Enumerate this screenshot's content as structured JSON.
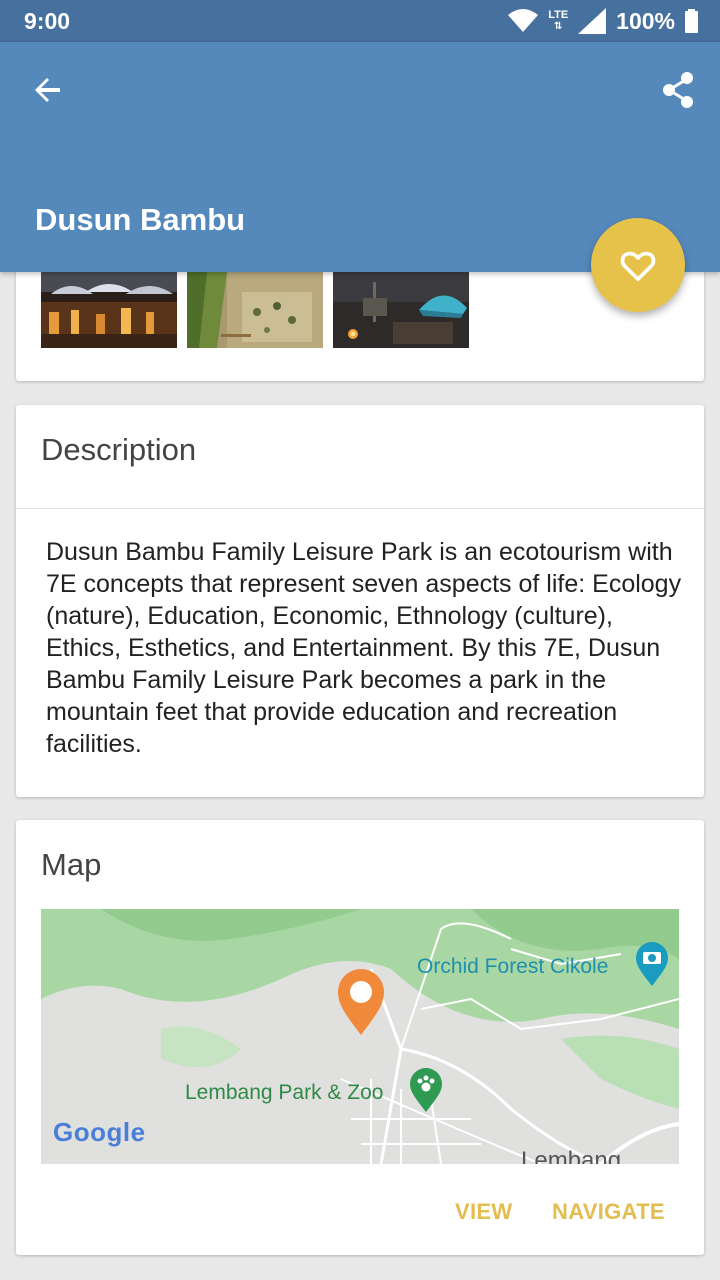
{
  "status_bar": {
    "time": "9:00",
    "network": "LTE",
    "battery": "100%"
  },
  "app_bar": {
    "title": "Dusun Bambu",
    "back_icon": "arrow-back-icon",
    "share_icon": "share-icon"
  },
  "fab": {
    "icon": "heart-outline-icon",
    "color": "#e6c24a"
  },
  "gallery": {
    "images": [
      "restaurant-umbrellas-photo",
      "rice-field-photo",
      "camping-tents-photo"
    ]
  },
  "description": {
    "title": "Description",
    "text": "Dusun Bambu Family Leisure Park is an ecotourism with 7E concepts that represent seven aspects of life: Ecology (nature), Education, Economic, Ethnology (culture), Ethics, Esthetics, and Entertainment. By this 7E, Dusun Bambu Family Leisure Park becomes a park in the mountain feet that provide education and recreation facilities."
  },
  "map": {
    "title": "Map",
    "labels": {
      "orchid": "Orchid Forest Cikole",
      "zoo": "Lembang Park & Zoo",
      "town": "Lembang"
    },
    "logo": "Google",
    "actions": {
      "view": "VIEW",
      "navigate": "NAVIGATE"
    }
  },
  "colors": {
    "status_bar": "#46709e",
    "app_bar": "#5589bb",
    "accent": "#e6c24a",
    "background": "#e8e8e8"
  }
}
